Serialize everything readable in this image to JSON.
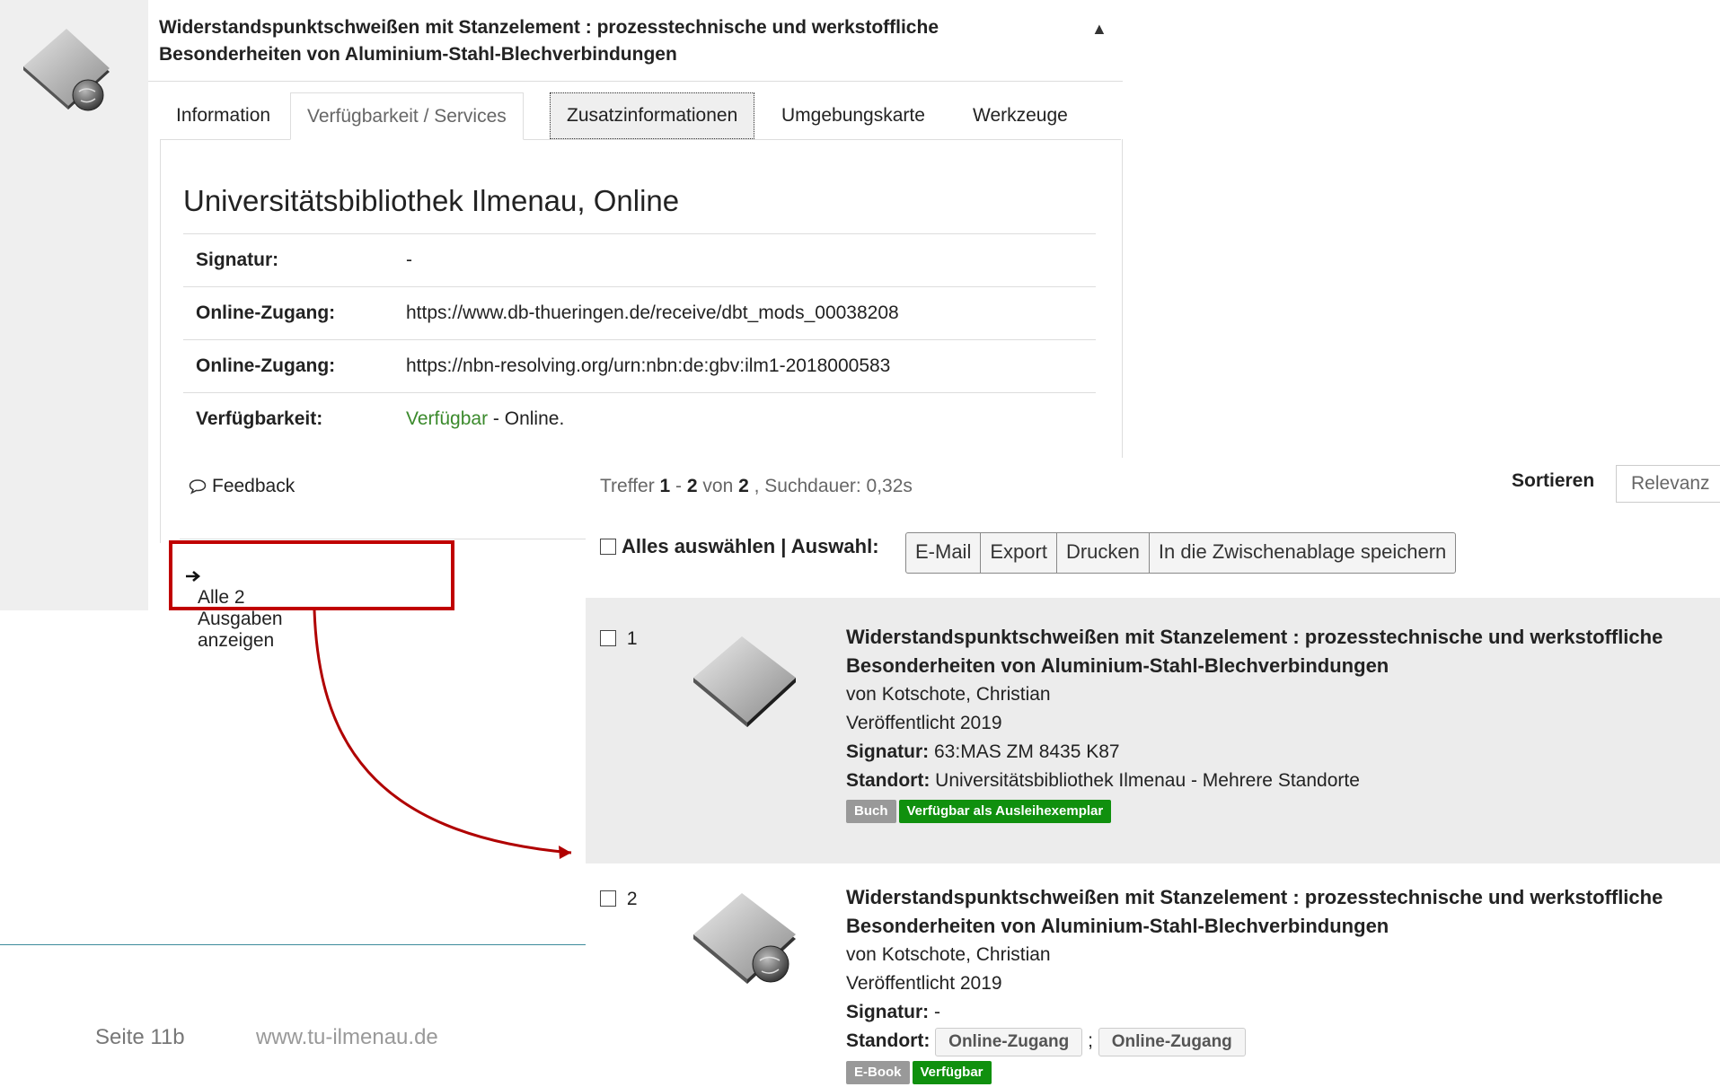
{
  "detail": {
    "title": "Widerstandspunktschweißen mit Stanzelement : prozesstechnische und werkstoffliche Besonderheiten von Aluminium-Stahl-Blechverbindungen",
    "collapse_glyph": "▲",
    "tabs": [
      {
        "label": "Information"
      },
      {
        "label": "Verfügbarkeit / Services"
      },
      {
        "label": "Zusatzinformationen"
      },
      {
        "label": "Umgebungskarte"
      },
      {
        "label": "Werkzeuge"
      }
    ],
    "library": "Universitätsbibliothek Ilmenau, Online",
    "rows": [
      {
        "label": "Signatur:",
        "value": "-"
      },
      {
        "label": "Online-Zugang:",
        "value": "https://www.db-thueringen.de/receive/dbt_mods_00038208"
      },
      {
        "label": "Online-Zugang:",
        "value": "https://nbn-resolving.org/urn:nbn:de:gbv:ilm1-2018000583"
      },
      {
        "label": "Verfügbarkeit:",
        "value_green": "Verfügbar",
        "value_rest": " - Online."
      }
    ],
    "feedback": "Feedback",
    "all_editions": "Alle 2 Ausgaben anzeigen"
  },
  "results": {
    "hits_prefix": "Treffer ",
    "hits_from": "1",
    "hits_dash": " - ",
    "hits_to": "2",
    "hits_of": " von ",
    "hits_total": "2",
    "hits_suffix": " , Suchdauer: 0,32s",
    "sort_label": "Sortieren",
    "sort_value": "Relevanz",
    "select_all": "Alles auswählen | Auswahl:",
    "buttons": [
      "E-Mail",
      "Export",
      "Drucken",
      "In die Zwischenablage speichern"
    ],
    "records": [
      {
        "num": "1",
        "title": "Widerstandspunktschweißen mit Stanzelement : prozesstechnische und werkstoffliche Besonderheiten von Aluminium-Stahl-Blechverbindungen",
        "author": "von Kotschote, Christian",
        "published": "Veröffentlicht 2019",
        "signatur_label": "Signatur:",
        "signatur_value": " 63:MAS ZM 8435 K87",
        "standort_label": "Standort:",
        "standort_value": " Universitätsbibliothek Ilmenau - Mehrere Standorte",
        "badge_type": "Buch",
        "badge_status": "Verfügbar als Ausleihexemplar"
      },
      {
        "num": "2",
        "title": "Widerstandspunktschweißen mit Stanzelement : prozesstechnische und werkstoffliche Besonderheiten von Aluminium-Stahl-Blechverbindungen",
        "author": "von Kotschote, Christian",
        "published": "Veröffentlicht 2019",
        "signatur_label": "Signatur:",
        "signatur_value": " -",
        "standort_label": "Standort:",
        "standort_link1": "Online-Zugang",
        "standort_sep": ";",
        "standort_link2": "Online-Zugang",
        "badge_type": "E-Book",
        "badge_status": "Verfügbar"
      }
    ]
  },
  "footer": {
    "page": "Seite 11b",
    "url": "www.tu-ilmenau.de"
  },
  "colors": {
    "highlight_frame": "#c00000",
    "available_green": "#10900e",
    "footer_rule": "#3d8b9b"
  },
  "icons": [
    "book-globe-icon",
    "chevron-up-icon",
    "speech-bubble-icon",
    "arrow-right-icon",
    "checkbox-icon"
  ]
}
